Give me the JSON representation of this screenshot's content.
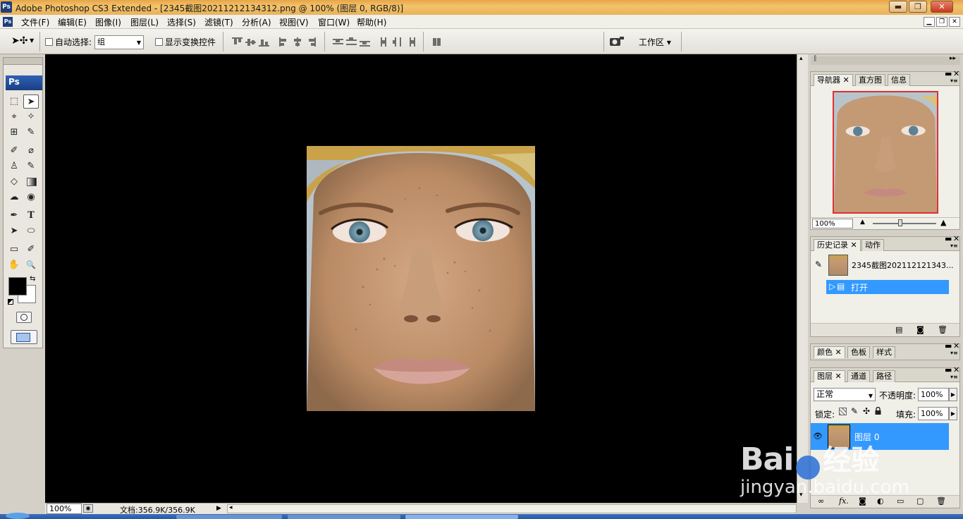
{
  "window": {
    "app_logo": "Ps",
    "title": "Adobe Photoshop CS3 Extended - [2345截图20211212134312.png @ 100% (图层 0, RGB/8)]",
    "min_symbol": "▬",
    "max_symbol": "❐",
    "close_symbol": "✕"
  },
  "menu": {
    "doc_icon": "Ps",
    "items": [
      "文件(F)",
      "编辑(E)",
      "图像(I)",
      "图层(L)",
      "选择(S)",
      "滤镜(T)",
      "分析(A)",
      "视图(V)",
      "窗口(W)",
      "帮助(H)"
    ],
    "mdi": [
      "▁",
      "❐",
      "✕"
    ]
  },
  "options": {
    "auto_select_label": "自动选择:",
    "auto_select_value": "组",
    "show_transform_label": "显示变换控件",
    "workspace_label": "工作区 ▾"
  },
  "toolbox": {
    "logo": "Ps",
    "tools": [
      "⬚",
      "➤",
      "⌖",
      "✧",
      "⊞",
      "✎",
      "✐",
      "⌀",
      "♙",
      "✎",
      "◇",
      "▬",
      "☁",
      "◉",
      "✒",
      "T",
      "➤",
      "⬭",
      "▭",
      "✐",
      "✋",
      "🔍"
    ]
  },
  "statusbar": {
    "zoom": "100%",
    "doc_info": "文档:356.9K/356.9K"
  },
  "navigator": {
    "tabs": [
      "导航器",
      "直方图",
      "信息"
    ],
    "zoom": "100%"
  },
  "history": {
    "tabs": [
      "历史记录",
      "动作"
    ],
    "snapshot_name": "2345截图202112121343...",
    "step_open": "打开"
  },
  "color_panel": {
    "tabs": [
      "颜色",
      "色板",
      "样式"
    ]
  },
  "layers": {
    "tabs": [
      "图层",
      "通道",
      "路径"
    ],
    "blend_mode": "正常",
    "opacity_label": "不透明度:",
    "opacity_value": "100%",
    "lock_label": "锁定:",
    "fill_label": "填充:",
    "fill_value": "100%",
    "layer_name": "图层 0"
  },
  "watermark": {
    "brand": "Bai",
    "brand_cn": "经验",
    "url": "jingyan.baidu.com"
  },
  "colors": {
    "titlebar": "#e9b15c",
    "selection": "#3399ff",
    "canvas_bg": "#000000",
    "nav_frame": "#e03030"
  }
}
